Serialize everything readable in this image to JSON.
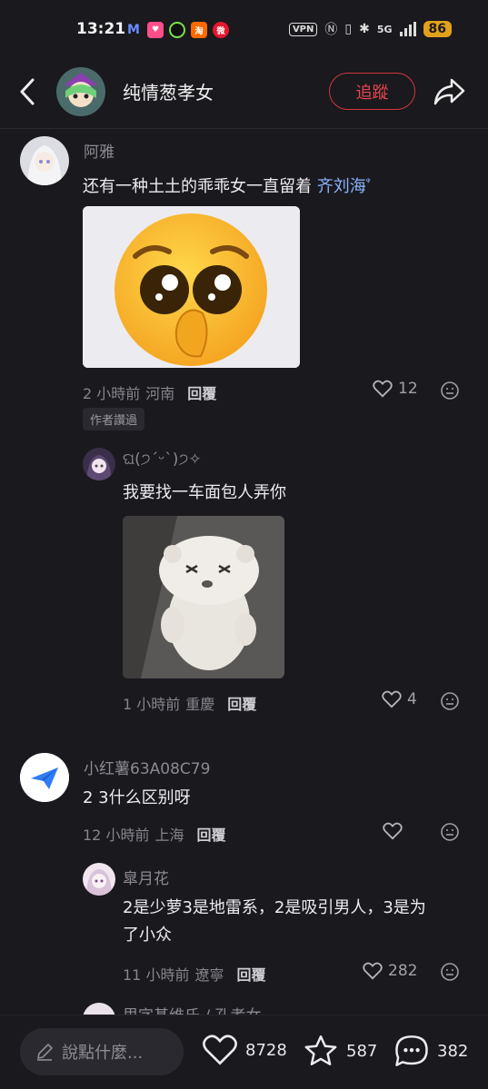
{
  "status_bar": {
    "time": "13:21",
    "vpn": "VPN",
    "network": "5G",
    "battery": "86"
  },
  "header": {
    "title": "纯情葱孝女",
    "follow_label": "追蹤"
  },
  "comments": [
    {
      "username": "阿雅",
      "text": "还有一种土土的乖乖女一直留着 ",
      "tag": "齐刘海",
      "time": "2 小時前",
      "location": "河南",
      "reply_label": "回覆",
      "likes": "12",
      "author_badge": "作者讚過"
    },
    {
      "username": "ଘ(੭ˊᵕˋ)੭✧",
      "text": "我要找一车面包人弄你",
      "time": "1 小時前",
      "location": "重慶",
      "reply_label": "回覆",
      "likes": "4"
    },
    {
      "username": "小红薯63A08C79",
      "text": "2 3什么区别呀",
      "time": "12 小時前",
      "location": "上海",
      "reply_label": "回覆",
      "likes": ""
    },
    {
      "username": "皐月花",
      "text_line1": "2是少萝3是地雷系，2是吸引男人，3是为",
      "text_line2": "了小众",
      "time": "11 小時前",
      "location": "遼寧",
      "reply_label": "回覆",
      "likes": "282"
    },
    {
      "username_partial": "里字基维氏 / 孔孝女"
    }
  ],
  "bottom_bar": {
    "input_placeholder": "說點什麼...",
    "likes": "8728",
    "favorites": "587",
    "comments": "382"
  },
  "colors": {
    "background": "#1a191e",
    "accent_red": "#d3373f",
    "link_blue": "#8ab4ff"
  }
}
